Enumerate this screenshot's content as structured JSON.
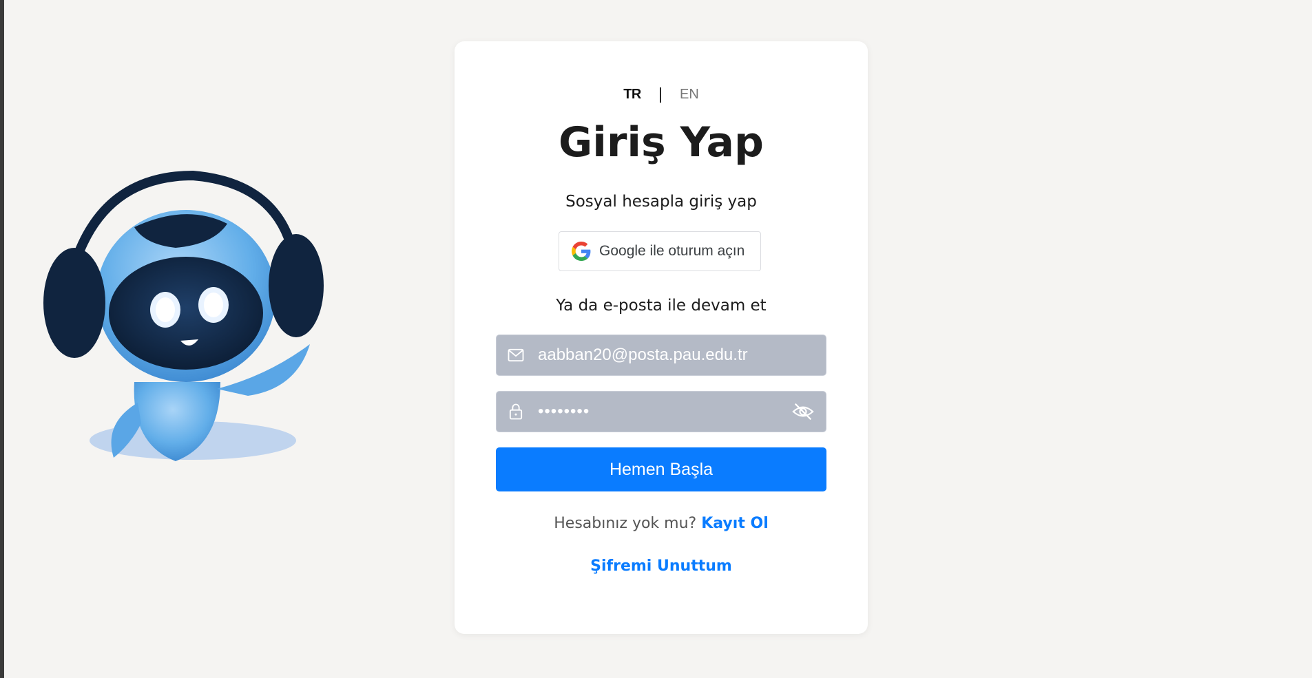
{
  "lang": {
    "tr": "TR",
    "separator": "|",
    "en": "EN"
  },
  "title": "Giriş Yap",
  "social_label": "Sosyal hesapla giriş yap",
  "google_button": {
    "label": "Google ile oturum açın",
    "icon": "google-g-icon"
  },
  "alt_label": "Ya da e-posta ile devam et",
  "email_field": {
    "value": "aabban20@posta.pau.edu.tr",
    "icon": "mail-icon"
  },
  "password_field": {
    "value": "••••••••",
    "icon": "lock-icon",
    "toggle_icon": "eye-off-icon"
  },
  "primary_button": "Hemen Başla",
  "signup": {
    "prompt": "Hesabınız yok mu?",
    "link": "Kayıt Ol"
  },
  "forgot_password": "Şifremi Unuttum",
  "colors": {
    "accent": "#0a7cff",
    "field_bg": "#b4bac6",
    "page_bg": "#f5f4f2"
  }
}
